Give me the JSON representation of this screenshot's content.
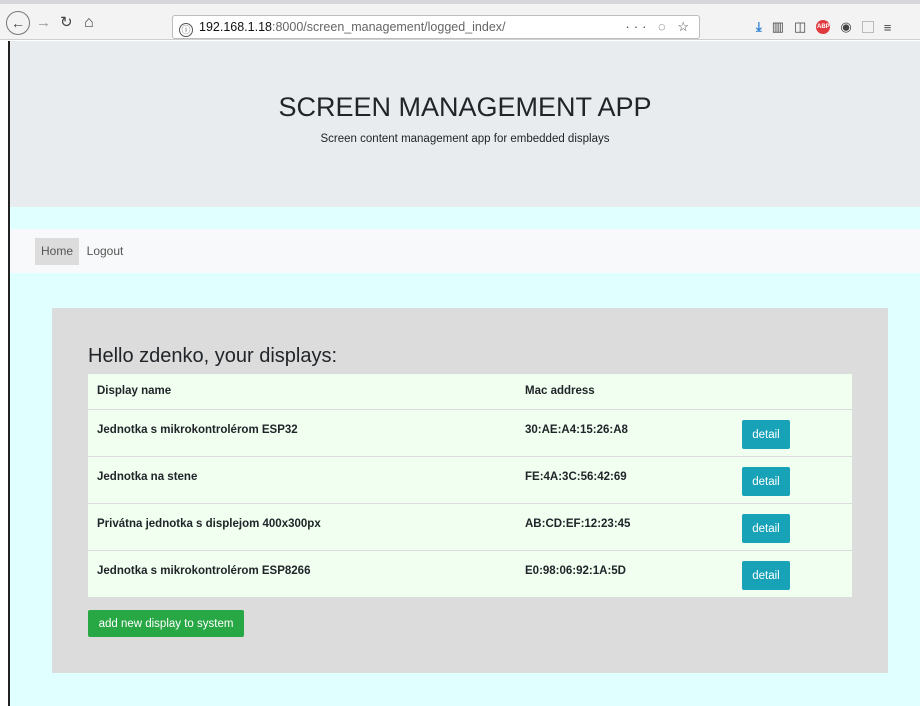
{
  "browser": {
    "url_info_icon": "ⓘ",
    "url_host": "192.168.1.18",
    "url_path": ":8000/screen_management/logged_index/",
    "url_actions": "··· ◌ ☆",
    "icons": [
      "back-arrow-icon",
      "forward-arrow-icon",
      "reload-icon",
      "home-icon",
      "download-icon",
      "library-icon",
      "sidebar-icon",
      "adblock-icon",
      "account-icon",
      "extension-icon",
      "menu-icon"
    ]
  },
  "header": {
    "title": "SCREEN MANAGEMENT APP",
    "subtitle": "Screen content management app for embedded displays"
  },
  "nav": {
    "items": [
      {
        "label": "Home"
      },
      {
        "label": "Logout"
      }
    ]
  },
  "main": {
    "heading": "Hello zdenko, your displays:",
    "table": {
      "columns": [
        "Display name",
        "Mac address"
      ],
      "rows": [
        {
          "name": "Jednotka s mikrokontrolérom ESP32",
          "mac": "30:AE:A4:15:26:A8",
          "action": "detail"
        },
        {
          "name": "Jednotka na stene",
          "mac": "FE:4A:3C:56:42:69",
          "action": "detail"
        },
        {
          "name": "Privátna jednotka s displejom 400x300px",
          "mac": "AB:CD:EF:12:23:45",
          "action": "detail"
        },
        {
          "name": "Jednotka s mikrokontrolérom ESP8266",
          "mac": "E0:98:06:92:1A:5D",
          "action": "detail"
        }
      ]
    },
    "add_button": "add new display to system"
  },
  "colors": {
    "page_bg": "#e0ffff",
    "header_bg": "#e9ecef",
    "card_bg": "#dcdcdc",
    "table_bg": "#f0fff0",
    "detail_button": "#17a2b8",
    "add_button": "#28a745"
  }
}
